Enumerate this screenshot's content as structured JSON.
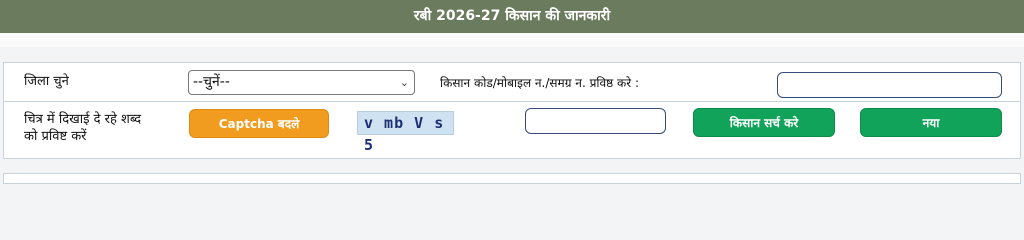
{
  "header": {
    "title": "रबी 2026-27 किसान की जानकारी"
  },
  "form": {
    "district_label": "जिला चुने",
    "district_select": {
      "selected": "--चुनें--"
    },
    "farmer_id_label": "किसान कोड/मोबाइल न./समग्र न. प्रविष्ठ करे :",
    "farmer_id_input": {
      "value": ""
    },
    "captcha_prompt_line1": "चित्र में दिखाई दे रहे शब्द",
    "captcha_prompt_line2": "को प्रविष्ट करें",
    "captcha_change_label": "Captcha बदले",
    "captcha_text": "v mb V s 5",
    "captcha_input": {
      "value": ""
    },
    "search_button_label": "किसान सर्च करे",
    "new_button_label": "नया"
  },
  "colors": {
    "header_bg": "#6b7b5e",
    "orange_button": "#f29c1f",
    "green_button": "#11a35a"
  }
}
